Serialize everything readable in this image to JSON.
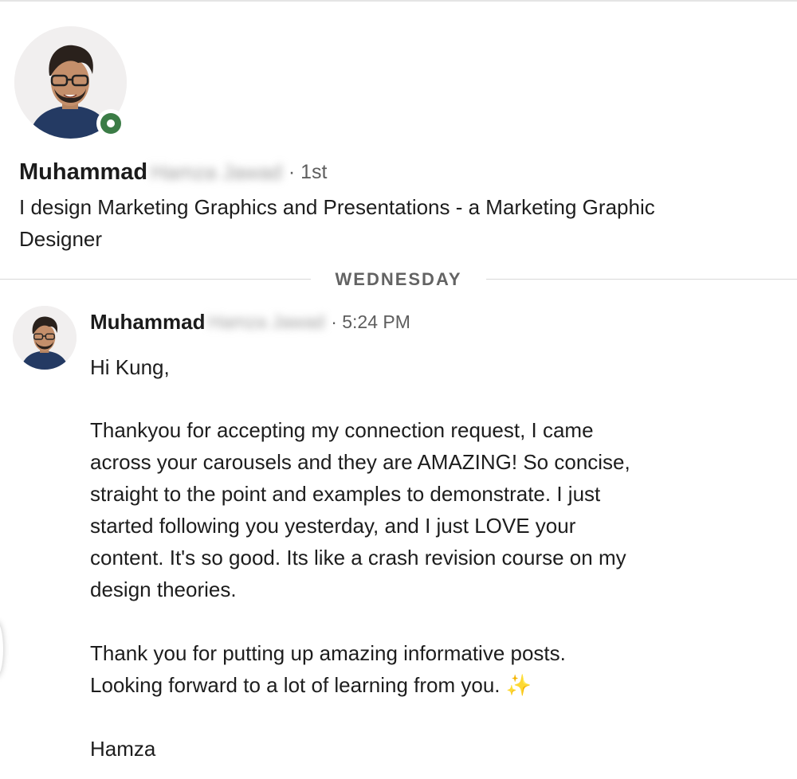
{
  "profile": {
    "first_name": "Muhammad",
    "surname_blurred": "Hamza Jawad",
    "degree": "· 1st",
    "headline_line1": "I design Marketing Graphics and Presentations - a Marketing Graphic",
    "headline_line2": "Designer",
    "online_status": "online"
  },
  "divider": {
    "label": "WEDNESDAY"
  },
  "message": {
    "sender_first": "Muhammad",
    "sender_surname_blurred": "Hamza Jawad",
    "time": "· 5:24 PM",
    "lines": [
      "Hi Kung,",
      "Thankyou for accepting my connection request, I came",
      "across your carousels and they are AMAZING! So concise,",
      "straight to the point and examples to demonstrate. I just",
      "started following you yesterday, and I just LOVE your",
      "content. It's so good. Its like a crash revision course on my",
      "design theories.",
      "Thank you for putting up amazing informative posts.",
      "Looking forward to a lot of learning from you.",
      "Hamza"
    ],
    "emoji": "✨"
  },
  "colors": {
    "online_green": "#3b7c46",
    "sparkle_gold": "#f2c23a",
    "text": "#1d1d1d",
    "muted": "#5e5e5e"
  }
}
